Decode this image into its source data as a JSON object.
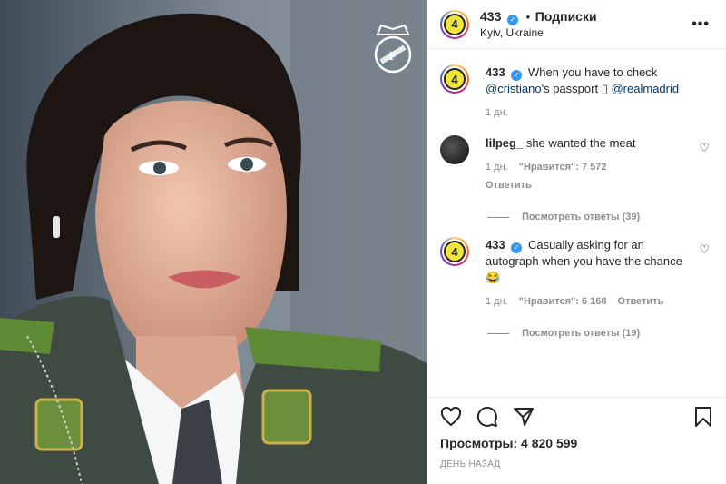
{
  "post": {
    "account": "433",
    "dot": "•",
    "follow_label": "Подписки",
    "location": "Kyiv, Ukraine",
    "more": "•••"
  },
  "caption": {
    "username": "433",
    "text_part1": "When you have to check",
    "mention1": "@cristiano",
    "text_part2": "'s passport",
    "emoji_box": "▯",
    "mention2": "@realmadrid",
    "time": "1 дн."
  },
  "comments": [
    {
      "username": "lilpeg_",
      "text": "she wanted the meat",
      "time": "1 дн.",
      "likes": "\"Нравится\": 7 572",
      "reply": "Ответить",
      "view_replies": "Посмотреть ответы (39)"
    },
    {
      "username": "433",
      "text": "Casually asking for an autograph when you have the chance",
      "emoji": "😂",
      "time": "1 дн.",
      "likes": "\"Нравится\": 6 168",
      "reply": "Ответить",
      "view_replies": "Посмотреть ответы (19)"
    }
  ],
  "footer": {
    "views": "Просмотры: 4 820 599",
    "date": "ДЕНЬ НАЗАД"
  },
  "avatar_text": "4",
  "colors": {
    "accent_link": "#00376b",
    "verified": "#3897f0",
    "muted": "#8e8e8e"
  },
  "icons": [
    "heart-icon",
    "comment-icon",
    "share-icon",
    "save-icon",
    "more-icon",
    "verified-icon",
    "real-madrid-crest"
  ]
}
